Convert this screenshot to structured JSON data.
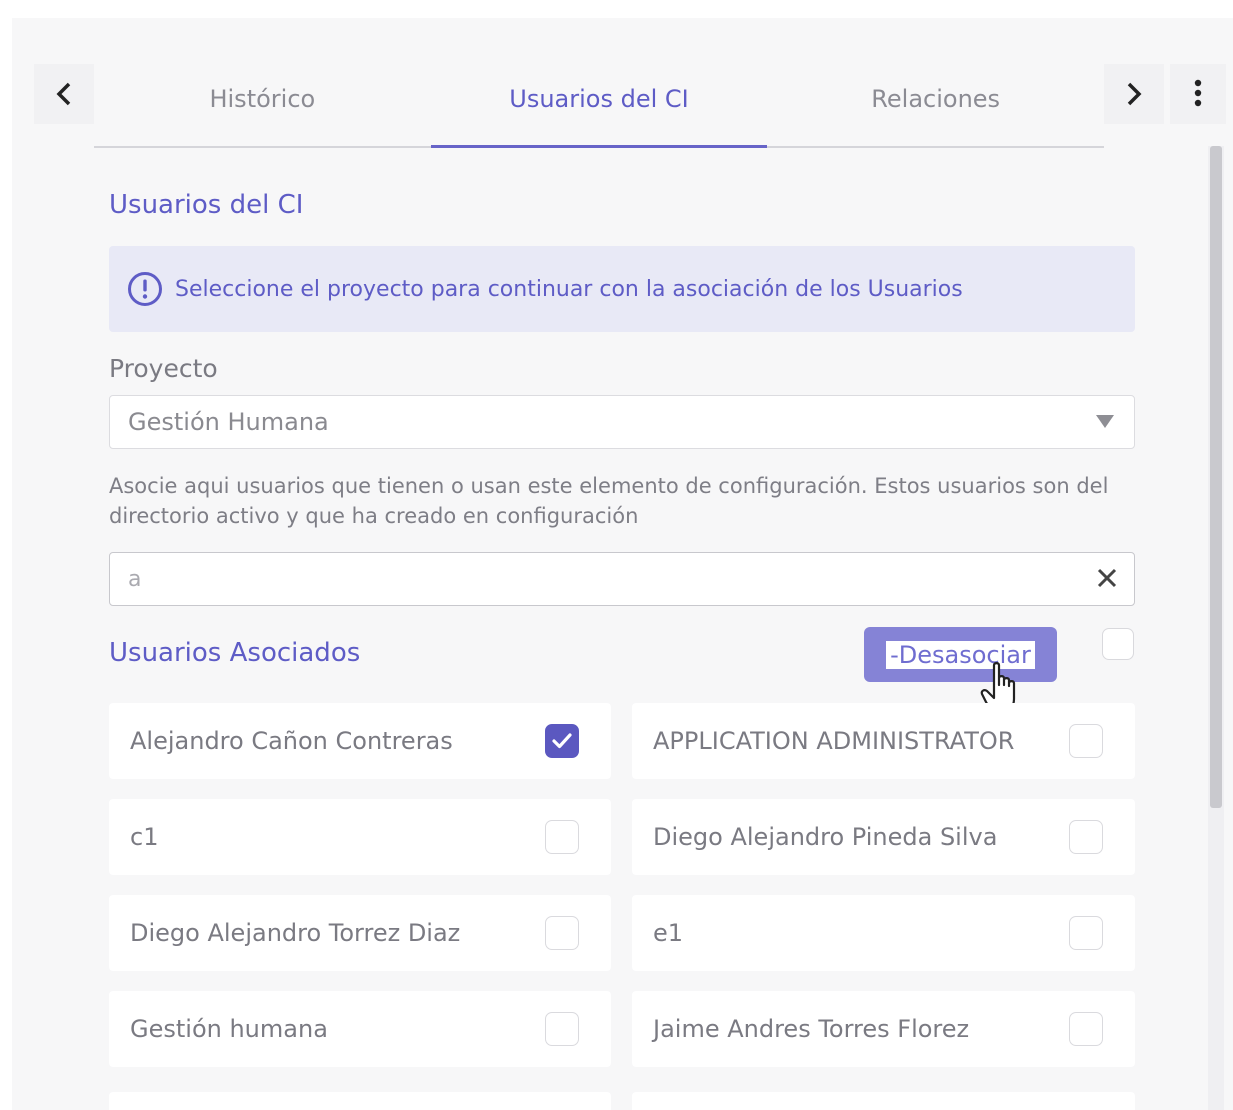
{
  "tabs": [
    {
      "label": "Histórico",
      "active": false
    },
    {
      "label": "Usuarios del CI",
      "active": true
    },
    {
      "label": "Relaciones",
      "active": false
    }
  ],
  "section_title": "Usuarios del CI",
  "info_message": "Seleccione el proyecto para continuar con la asociación de los Usuarios",
  "project": {
    "label": "Proyecto",
    "selected": "Gestión Humana"
  },
  "help_text": "Asocie aqui usuarios que tienen o usan este elemento de configuración. Estos usuarios son del directorio activo y que ha creado en configuración",
  "search": {
    "value": "a"
  },
  "associated": {
    "title": "Usuarios Asociados",
    "disassociate_label": "-Desasociar",
    "select_all_checked": false
  },
  "users": [
    {
      "name": "Alejandro Cañon Contreras",
      "checked": true
    },
    {
      "name": "APPLICATION ADMINISTRATOR",
      "checked": false
    },
    {
      "name": "c1",
      "checked": false
    },
    {
      "name": "Diego Alejandro Pineda Silva",
      "checked": false
    },
    {
      "name": "Diego Alejandro Torrez Diaz",
      "checked": false
    },
    {
      "name": "e1",
      "checked": false
    },
    {
      "name": "Gestión humana",
      "checked": false
    },
    {
      "name": "Jaime Andres Torres Florez",
      "checked": false
    }
  ],
  "colors": {
    "accent": "#5e5cc6",
    "button_bg": "#8583d6",
    "info_bg": "#e8e9f6"
  }
}
